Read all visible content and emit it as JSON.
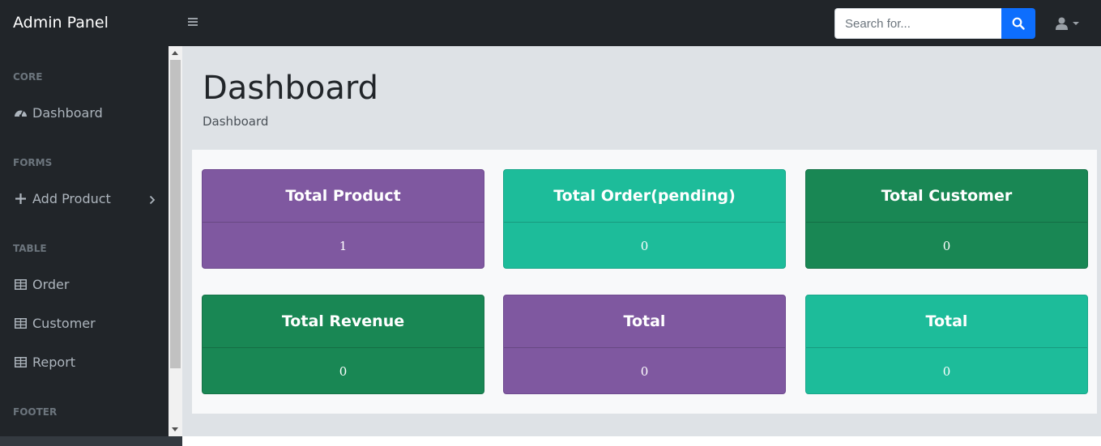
{
  "app": {
    "brand": "Admin Panel"
  },
  "search": {
    "placeholder": "Search for..."
  },
  "sidebar": {
    "headings": {
      "core": "CORE",
      "forms": "FORMS",
      "table": "TABLE",
      "footer": "FOOTER"
    },
    "items": [
      {
        "label": "Dashboard",
        "icon": "dashboard-icon"
      },
      {
        "label": "Add Product",
        "icon": "plus-icon"
      },
      {
        "label": "Order",
        "icon": "table-icon"
      },
      {
        "label": "Customer",
        "icon": "table-icon"
      },
      {
        "label": "Report",
        "icon": "table-icon"
      }
    ]
  },
  "page": {
    "title": "Dashboard",
    "breadcrumb": "Dashboard"
  },
  "cards": [
    {
      "title": "Total Product",
      "value": "1",
      "color": "#7f58a0"
    },
    {
      "title": "Total Order(pending)",
      "value": "0",
      "color": "#1dbc9a"
    },
    {
      "title": "Total Customer",
      "value": "0",
      "color": "#198754"
    },
    {
      "title": "Total Revenue",
      "value": "0",
      "color": "#198754"
    },
    {
      "title": "Total",
      "value": "0",
      "color": "#7f58a0"
    },
    {
      "title": "Total",
      "value": "0",
      "color": "#1dbc9a"
    }
  ],
  "colors": {
    "navbar": "#212529",
    "primary": "#0d6efd",
    "content_bg": "#dee2e6"
  }
}
